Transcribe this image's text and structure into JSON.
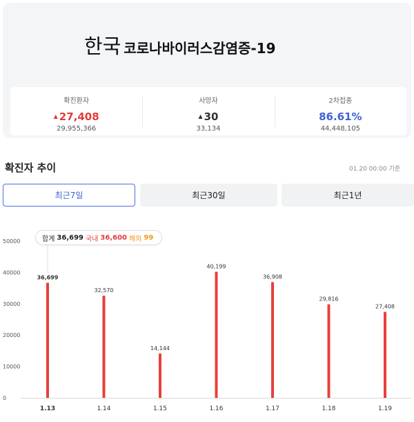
{
  "header": {
    "country": "한국",
    "disease": "코로나바이러스감염증-19"
  },
  "stats": [
    {
      "label": "확진환자",
      "change": "27,408",
      "total": "29,955,366",
      "arrow": "▲",
      "color": "#e23b3b"
    },
    {
      "label": "사망자",
      "change": "30",
      "total": "33,134",
      "arrow": "▲",
      "color": "#333333"
    },
    {
      "label": "2차접종",
      "change": "86.61%",
      "total": "44,448,105",
      "arrow": "",
      "color": "#3d61d6"
    }
  ],
  "section": {
    "title": "확진자 추이",
    "timestamp": "01.20 00:00 기준"
  },
  "tabs": [
    {
      "label": "최근7일",
      "active": true
    },
    {
      "label": "최근30일",
      "active": false
    },
    {
      "label": "최근1년",
      "active": false
    }
  ],
  "tooltip": {
    "total_label": "합계",
    "total_value": "36,699",
    "domestic_label": "국내",
    "domestic_value": "36,600",
    "overseas_label": "해외",
    "overseas_value": "99"
  },
  "chart_data": {
    "type": "bar",
    "categories": [
      "1.13",
      "1.14",
      "1.15",
      "1.16",
      "1.17",
      "1.18",
      "1.19"
    ],
    "values": [
      36699,
      32570,
      14144,
      40199,
      36908,
      29816,
      27408
    ],
    "value_labels": [
      "36,699",
      "32,570",
      "14,144",
      "40,199",
      "36,908",
      "29,816",
      "27,408"
    ],
    "ylim": [
      0,
      50000
    ],
    "yticks": [
      0,
      10000,
      20000,
      30000,
      40000,
      50000
    ],
    "bar_color": "#e8403a",
    "highlight_index": 0,
    "grid": false
  }
}
